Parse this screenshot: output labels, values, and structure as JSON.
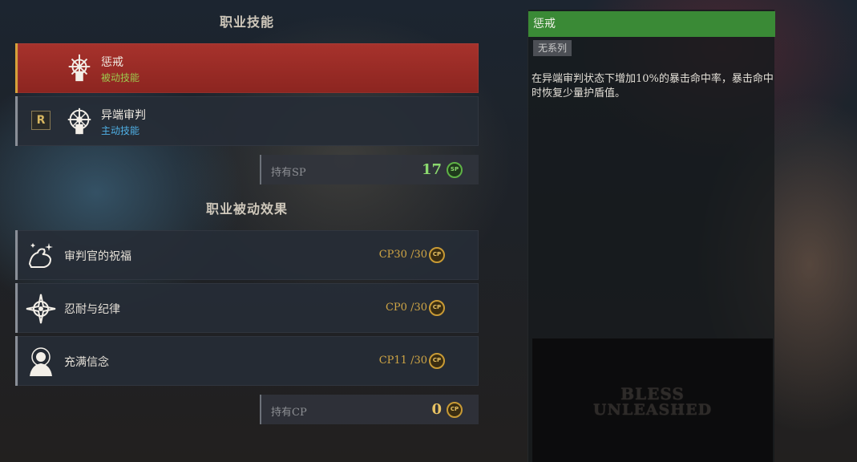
{
  "class_skills": {
    "title": "职业技能",
    "items": [
      {
        "name": "惩戒",
        "type": "被动技能",
        "key": ""
      },
      {
        "name": "异端审判",
        "type": "主动技能",
        "key": "R"
      }
    ],
    "sp_label": "持有SP",
    "sp_value": "17",
    "sp_icon_text": "SP"
  },
  "class_passives": {
    "title": "职业被动效果",
    "items": [
      {
        "name": "审判官的祝福",
        "cp": "CP30 /30"
      },
      {
        "name": "忍耐与纪律",
        "cp": "CP0 /30"
      },
      {
        "name": "充满信念",
        "cp": "CP11 /30"
      }
    ],
    "cp_label": "持有CP",
    "cp_value": "0",
    "cp_icon_text": "CP"
  },
  "detail": {
    "title": "惩戒",
    "tag": "无系列",
    "description": "在异端审判状态下增加10%的暴击命中率，暴击命中时恢复少量护盾值。",
    "logo_line1": "BLESS",
    "logo_line2": "UNLEASHED"
  },
  "colors": {
    "active_card": "#a7322c",
    "detail_header": "#3a8a36",
    "passive_text": "#9cc94e",
    "active_text": "#4fb0e6",
    "sp_green": "#5fb246",
    "cp_gold": "#c89a35"
  }
}
